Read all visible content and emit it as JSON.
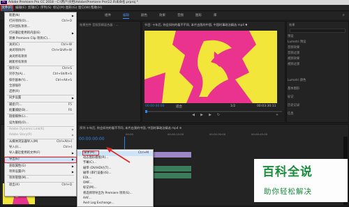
{
  "window": {
    "title": "Adobe Premiere Pro CC 2018 - C:\\用户\\文档\\Adobe\\Premiere Pro\\12.0\\未命名.prproj *",
    "logo": "Pr"
  },
  "menubar": {
    "items": [
      "文件(F)",
      "编辑(E)",
      "剪辑(C)",
      "序列(S)",
      "标记(M)",
      "图形(G)",
      "窗口(W)",
      "帮助(H)"
    ]
  },
  "workspace_tabs": [
    "组件",
    "编辑",
    "颜色",
    "效果",
    "音频",
    "图形",
    "库"
  ],
  "source_monitor": {
    "title": "效果控件 音频剪辑混合器 : ..."
  },
  "program_monitor": {
    "title": "节目: 十年后, 你会如何的看不不同, 本片由我的中国, 中国时事政治精选 mp4 ▼",
    "timecode_left": "00:00:00:00",
    "fit": "适合",
    "ratio": "1/2",
    "timecode_right": "00:03:30:11"
  },
  "effects_panel": {
    "title": "效果",
    "items": [
      "预设",
      "Lumetri 预设",
      "音频效果",
      "音频过渡",
      "视频效果",
      "视频过渡"
    ],
    "lower_items": [
      "Lumetri 颜色",
      "基本图形",
      "标记",
      "历史记录",
      "信息"
    ]
  },
  "timeline": {
    "title": "序列 十年后, 你会如何的看不不同, 本片由我的中国, 中国时事政治精选 mp4 ≡",
    "timecode": "00:00:00:00",
    "ruler_labels": [
      "00:00",
      "00:00:15:00",
      "00:00:30:00",
      "00:00:45:00"
    ]
  },
  "file_menu": {
    "items": [
      {
        "label": "新建(N)",
        "shortcut": "",
        "submenu": true,
        "disabled": false
      },
      {
        "label": "打开项目(O)...",
        "shortcut": "Ctrl+O",
        "submenu": false,
        "disabled": false
      },
      {
        "label": "打开团队项目...",
        "shortcut": "",
        "submenu": false,
        "disabled": false
      },
      {
        "label": "打开最近使用的内容(E)",
        "shortcut": "",
        "submenu": true,
        "disabled": false
      },
      {
        "label": "转换 Premiere Clip 项目(C)...",
        "shortcut": "",
        "submenu": false,
        "disabled": false
      },
      {
        "label": "关闭(C)",
        "shortcut": "Ctrl+W",
        "submenu": false,
        "disabled": false
      },
      {
        "label": "关闭项目(P)",
        "shortcut": "Ctrl+Shift+W",
        "submenu": false,
        "disabled": false
      },
      {
        "label": "关闭所有项目",
        "shortcut": "",
        "submenu": false,
        "disabled": false
      },
      {
        "label": "刷新所有项目",
        "shortcut": "",
        "submenu": false,
        "disabled": false
      },
      {
        "label": "保存(S)",
        "shortcut": "Ctrl+S",
        "submenu": false,
        "disabled": false
      },
      {
        "label": "另存为(A)...",
        "shortcut": "Ctrl+Shift+S",
        "submenu": false,
        "disabled": false
      },
      {
        "label": "保存副本(Y)...",
        "shortcut": "Ctrl+Alt+S",
        "submenu": false,
        "disabled": false
      },
      {
        "label": "全部保存",
        "shortcut": "",
        "submenu": false,
        "disabled": false
      },
      {
        "label": "还原(R)",
        "shortcut": "",
        "submenu": false,
        "disabled": false
      },
      {
        "label": "同步设置",
        "shortcut": "",
        "submenu": true,
        "disabled": false
      },
      {
        "label": "捕捉(T)...",
        "shortcut": "F5",
        "submenu": false,
        "disabled": false
      },
      {
        "label": "批量捕捉(B)...",
        "shortcut": "F6",
        "submenu": false,
        "disabled": false
      },
      {
        "label": "链接媒体(L)...",
        "shortcut": "",
        "submenu": false,
        "disabled": false
      },
      {
        "label": "设为脱机(O)...",
        "shortcut": "",
        "submenu": false,
        "disabled": false
      },
      {
        "label": "Adobe Dynamic Link(K)",
        "shortcut": "",
        "submenu": true,
        "disabled": true
      },
      {
        "label": "Adobe Story(R)",
        "shortcut": "",
        "submenu": true,
        "disabled": true
      },
      {
        "label": "从媒体浏览器导入(M)",
        "shortcut": "Ctrl+Alt+I",
        "submenu": false,
        "disabled": false
      },
      {
        "label": "导入(I)...",
        "shortcut": "Ctrl+I",
        "submenu": false,
        "disabled": false
      },
      {
        "label": "导入最近使用的文件(F)",
        "shortcut": "",
        "submenu": true,
        "disabled": false
      },
      {
        "label": "导出(E)",
        "shortcut": "",
        "submenu": true,
        "disabled": false,
        "highlighted": true
      },
      {
        "label": "获取属性(G)",
        "shortcut": "",
        "submenu": true,
        "disabled": false
      },
      {
        "label": "项目设置(P)",
        "shortcut": "",
        "submenu": true,
        "disabled": false
      },
      {
        "label": "项目管理(M)...",
        "shortcut": "",
        "submenu": false,
        "disabled": false
      },
      {
        "label": "退出(X)",
        "shortcut": "Ctrl+Q",
        "submenu": false,
        "disabled": false
      }
    ]
  },
  "export_submenu": {
    "items": [
      {
        "label": "媒体(M)...",
        "shortcut": "Ctrl+M",
        "selected": true
      },
      {
        "label": "动态图形模板(R)...",
        "shortcut": "",
        "selected": false
      },
      {
        "label": "字幕(C)...",
        "shortcut": "",
        "selected": false
      },
      {
        "label": "磁带 (DV/HDV)(T)...",
        "shortcut": "",
        "selected": false
      },
      {
        "label": "磁带 (串行设备)(S)...",
        "shortcut": "",
        "selected": false
      },
      {
        "label": "EDL...",
        "shortcut": "",
        "selected": false
      },
      {
        "label": "OMF...",
        "shortcut": "",
        "selected": false
      },
      {
        "label": "标记(M)...",
        "shortcut": "",
        "selected": false
      },
      {
        "label": "将选择项导出为 Premiere 项目(S)...",
        "shortcut": "",
        "selected": false
      },
      {
        "label": "AAF...",
        "shortcut": "",
        "selected": false
      },
      {
        "label": "Avid Log Exchange...",
        "shortcut": "",
        "selected": false
      }
    ]
  },
  "watermark": {
    "title": "百科全说",
    "subtitle": "助你轻松解决"
  },
  "colors": {
    "accent": "#2b86e8",
    "highlight_box": "#e0282a",
    "video_yellow": "#f2e63a",
    "video_magenta": "#e9338f"
  }
}
